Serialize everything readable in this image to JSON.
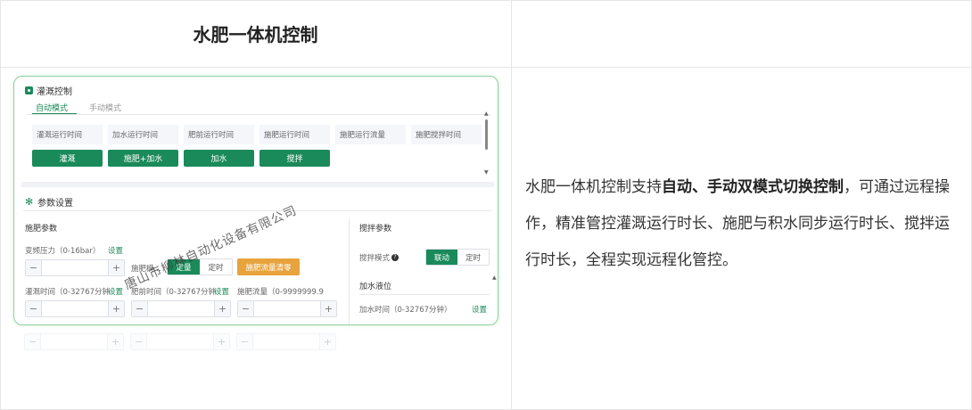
{
  "header": {
    "title": "水肥一体机控制"
  },
  "description": {
    "part1": "水肥一体机控制支持",
    "bold": "自动、手动双模式切换控制",
    "part2": "，可通过远程操作，精准管控灌溉运行时长、施肥与积水同步运行时长、搅拌运行时长，全程实现远程化管控。"
  },
  "irrigation": {
    "title": "灌溉控制",
    "tabs": [
      "自动模式",
      "手动模式"
    ],
    "metrics": [
      "灌溉运行时间",
      "加水运行时间",
      "肥前运行时间",
      "施肥运行时间",
      "施肥运行流量",
      "施肥搅拌时间"
    ],
    "buttons": [
      "灌溉",
      "施肥+加水",
      "加水",
      "搅拌"
    ]
  },
  "params": {
    "title": "参数设置",
    "fert_section": "施肥参数",
    "pressure_label": "变频压力（0-16bar）",
    "set_label": "设置",
    "fert_mode_label": "施肥模...",
    "mode_quant": "定量",
    "mode_timed": "定时",
    "clear_button": "施肥流量清零",
    "irr_time_label": "灌溉时间（0-32767分钟",
    "fert_time_label": "肥前时间（0-32767分钟",
    "fert_flow_label": "施肥流量（0-9999999.9",
    "stir_section": "搅拌参数",
    "stir_mode_label": "搅拌模式",
    "mode_link": "联动",
    "water_level": "加水液位",
    "water_time_label": "加水时间（0-32767分钟）"
  },
  "watermark": "唐山市柳林自动化设备有限公司"
}
